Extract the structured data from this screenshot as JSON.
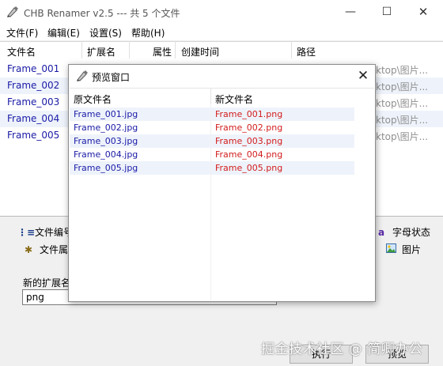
{
  "window": {
    "title": "CHB Renamer v2.5 --- 共 5 个文件",
    "minimize": "—",
    "maximize": "☐",
    "close": "✕"
  },
  "menu": [
    "文件(F)",
    "编辑(E)",
    "设置(S)",
    "帮助(H)"
  ],
  "table": {
    "columns": [
      "文件名",
      "扩展名",
      "属性",
      "创建时间",
      "路径"
    ],
    "rows": [
      {
        "name": "Frame_001",
        "path": "ktop\\图片..."
      },
      {
        "name": "Frame_002",
        "path": "ktop\\图片..."
      },
      {
        "name": "Frame_003",
        "path": "ktop\\图片..."
      },
      {
        "name": "Frame_004",
        "path": "ktop\\图片..."
      },
      {
        "name": "Frame_005",
        "path": "ktop\\图片..."
      }
    ]
  },
  "tools": {
    "file_number": "文件编号",
    "file_attr": "文件属",
    "letter_status": "字母状态",
    "letter_icon_text": "a",
    "image": "图片"
  },
  "new_ext": {
    "label": "新的扩展名",
    "value": "png"
  },
  "buttons": {
    "execute": "执行",
    "preview": "预览"
  },
  "watermark": "掘金技术社区 @ 简卿办公",
  "dialog": {
    "title": "预览窗口",
    "close": "✕",
    "columns": [
      "原文件名",
      "新文件名"
    ],
    "rows": [
      {
        "old": "Frame_001.jpg",
        "new": "Frame_001.png"
      },
      {
        "old": "Frame_002.jpg",
        "new": "Frame_002.png"
      },
      {
        "old": "Frame_003.jpg",
        "new": "Frame_003.png"
      },
      {
        "old": "Frame_004.jpg",
        "new": "Frame_004.png"
      },
      {
        "old": "Frame_005.jpg",
        "new": "Frame_005.png"
      }
    ]
  },
  "colors": {
    "link_blue": "#1a1aa6",
    "new_name_red": "#d21c1c",
    "row_highlight": "#eef3fb"
  }
}
